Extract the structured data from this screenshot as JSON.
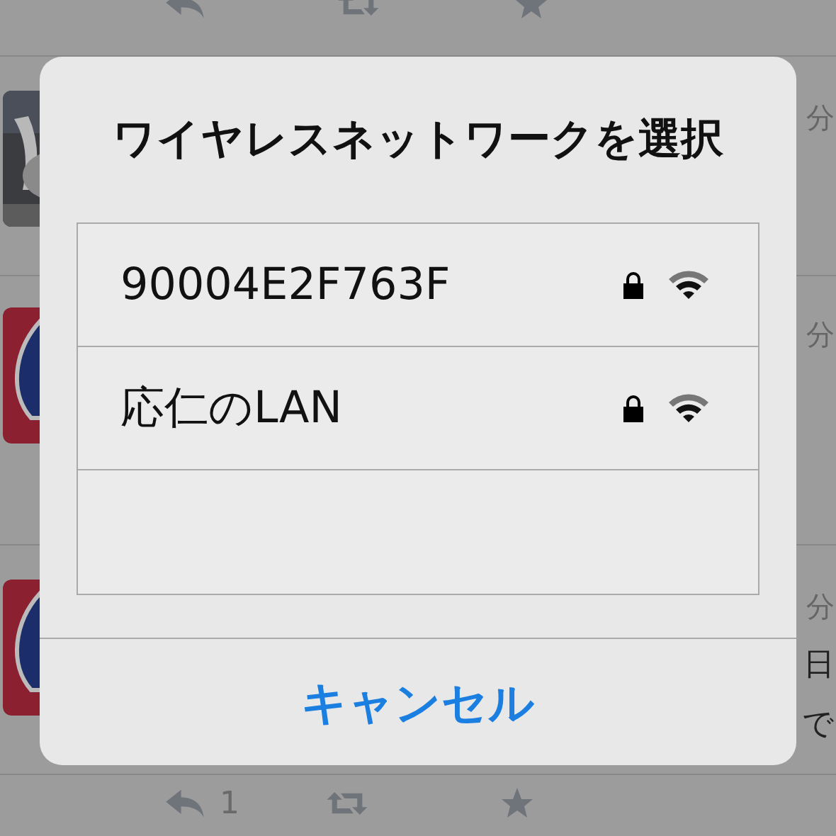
{
  "timeline": {
    "tweets": [
      {
        "kind": "picture",
        "time": "分"
      },
      {
        "kind": "logo",
        "time": "分"
      },
      {
        "kind": "logo",
        "time": "分",
        "lines": [
          "日",
          "で"
        ]
      }
    ],
    "bottom_actions": {
      "reply_count": "1"
    }
  },
  "dialog": {
    "title": "ワイヤレスネットワークを選択",
    "networks": [
      {
        "name": "90004E2F763F",
        "secured": true
      },
      {
        "name": "応仁のLAN",
        "secured": true
      }
    ],
    "cancel": "キャンセル"
  }
}
